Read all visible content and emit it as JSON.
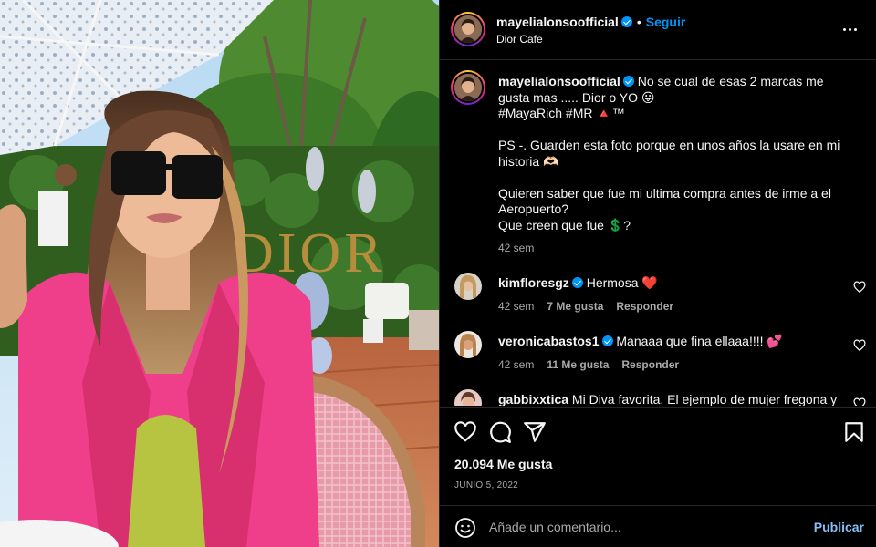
{
  "post": {
    "username": "mayelialonsoofficial",
    "separator": "•",
    "follow_label": "Seguir",
    "location": "Dior Cafe",
    "more_icon": "more-horizontal-icon",
    "photo_sign_text": "DIOR"
  },
  "caption": {
    "username": "mayelialonsoofficial",
    "text": "No se cual de esas 2 marcas me gusta mas ..... Dior o YO 😛\n#MayaRich #MR 🔺™\n\nPS -. Guarden esta foto porque en unos años la usare en mi historia 🫶🏻\n\nQuieren saber que fue mi ultima compra antes de irme a el Aeropuerto?\nQue creen que fue 💲?",
    "time": "42 sem"
  },
  "comments": [
    {
      "username": "kimfloresgz",
      "text": "Hermosa ❤️",
      "time": "42 sem",
      "likes": "7 Me gusta",
      "reply": "Responder"
    },
    {
      "username": "veronicabastos1",
      "text": "Manaaa que fina ellaaa!!!! 💕",
      "time": "42 sem",
      "likes": "11 Me gusta",
      "reply": "Responder"
    },
    {
      "username": "gabbixxtica",
      "text": "Mi Diva favorita. El ejemplo de mujer fregona y"
    }
  ],
  "actions": {
    "like_icon": "heart-icon",
    "comment_icon": "comment-icon",
    "share_icon": "share-icon",
    "save_icon": "bookmark-icon",
    "likes_text": "20.094 Me gusta",
    "date": "JUNIO 5, 2022"
  },
  "add_comment": {
    "emoji_icon": "emoji-icon",
    "placeholder": "Añade un comentario...",
    "publish_label": "Publicar"
  },
  "colors": {
    "accent": "#0095f6",
    "publish_disabled": "#85bff5",
    "background": "#000000",
    "text_secondary": "#a8a8a8"
  }
}
